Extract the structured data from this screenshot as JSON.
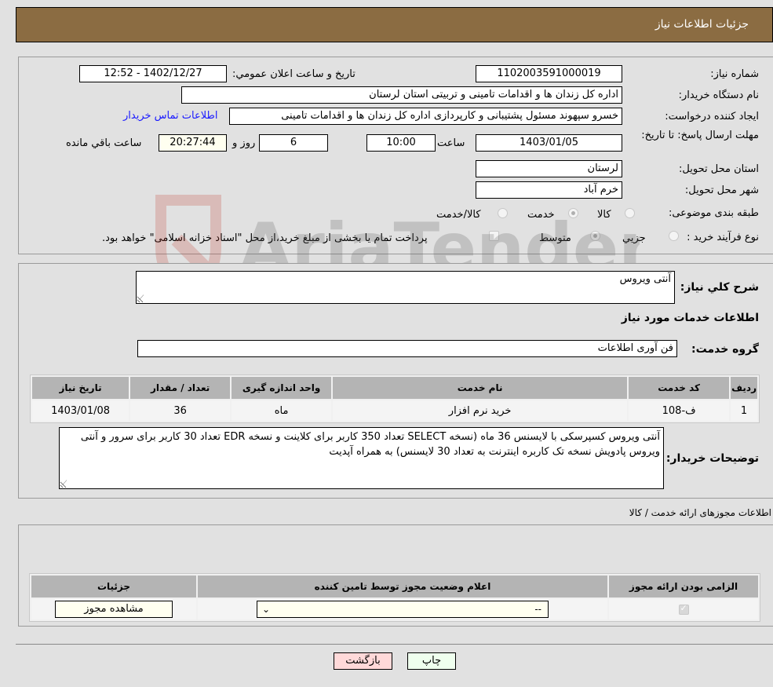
{
  "header": {
    "title": "جزئیات اطلاعات نیاز"
  },
  "need_info": {
    "need_number_label": "شماره نیاز:",
    "need_number": "1102003591000019",
    "announce_datetime_label": "تاریخ و ساعت اعلان عمومي:",
    "announce_datetime": "1402/12/27 - 12:52",
    "buyer_org_label": "نام دستگاه خریدار:",
    "buyer_org": "اداره کل زندان ها و اقدامات تامینی و تربیتی استان لرستان",
    "creator_label": "ایجاد کننده درخواست:",
    "creator": "خسرو سپهوند مسئول پشتیبانی و کارپردازی اداره کل زندان ها و اقدامات تامینی",
    "contact_link": "اطلاعات تماس خریدار",
    "deadline_label": "مهلت ارسال پاسخ: تا تاریخ:",
    "deadline_date": "1403/01/05",
    "time_label": "ساعت",
    "deadline_time": "10:00",
    "days_value": "6",
    "days_label": "روز و",
    "remaining_time": "20:27:44",
    "remaining_label": "ساعت باقي مانده",
    "province_label": "استان محل تحویل:",
    "province": "لرستان",
    "city_label": "شهر محل تحویل:",
    "city": "خرم آباد",
    "category_label": "طبقه بندی موضوعی:",
    "category_options": [
      {
        "label": "کالا",
        "checked": false
      },
      {
        "label": "خدمت",
        "checked": true
      },
      {
        "label": "کالا/خدمت",
        "checked": false
      }
    ],
    "process_label": "نوع فرآیند خرید :",
    "process_options": [
      {
        "label": "جزيي",
        "checked": false
      },
      {
        "label": "متوسط",
        "checked": true
      }
    ],
    "treasury_note": "پرداخت تمام یا بخشی از مبلغ خرید،از محل \"اسناد خزانه اسلامی\" خواهد بود."
  },
  "description": {
    "general_label": "شرح كلي نياز:",
    "general_value": "آنتی ویروس",
    "services_heading": "اطلاعات خدمات مورد نیاز",
    "service_group_label": "گروه خدمت:",
    "service_group": "فن آوری اطلاعات"
  },
  "services_table": {
    "headers": [
      "ردیف",
      "کد خدمت",
      "نام خدمت",
      "واحد اندازه گیری",
      "تعداد / مقدار",
      "تاریخ نیاز"
    ],
    "rows": [
      [
        "1",
        "ف-108",
        "خرید نرم افزار",
        "ماه",
        "36",
        "1403/01/08"
      ]
    ]
  },
  "buyer_notes": {
    "label": "توضیحات خریدار:",
    "value": "آنتی ویروس کسپرسکی با لایسنس 36 ماه (نسخه SELECT تعداد 350 کاربر برای کلاینت و نسخه EDR تعداد 30 کاربر برای سرور و  آنتی ویروس پادویش نسخه تک کاربره اینترنت به تعداد 30 لایسنس) به همراه آپدیت"
  },
  "permits": {
    "title": "اطلاعات مجوزهای ارائه خدمت / کالا",
    "headers": [
      "الزامی بودن ارائه مجوز",
      "اعلام وضعیت مجوز توسط تامین کننده",
      "جزئیات"
    ],
    "row": {
      "required_checked": true,
      "status_selected": "--",
      "details_button": "مشاهده مجوز"
    }
  },
  "footer": {
    "print_label": "چاپ",
    "back_label": "بازگشت"
  },
  "watermark": {
    "text": "AriaTender.neT"
  }
}
